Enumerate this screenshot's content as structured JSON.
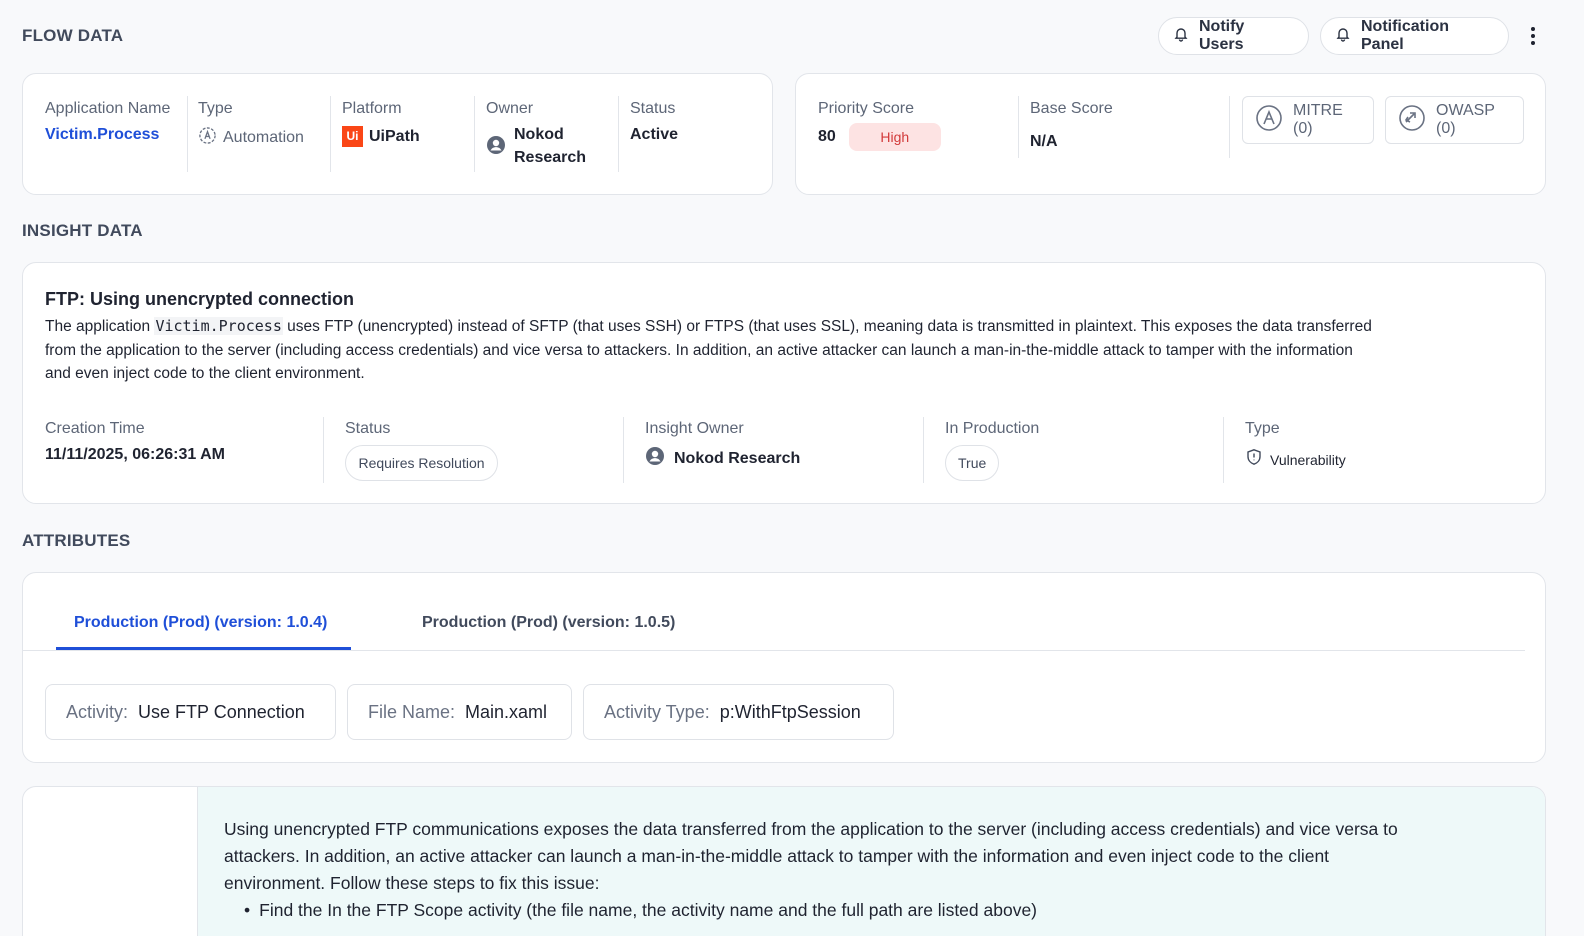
{
  "flow": {
    "section_title": "FLOW DATA",
    "notify_users_label": "Notify Users",
    "notification_panel_label": "Notification Panel",
    "application_name_label": "Application Name",
    "application_name": "Victim.Process",
    "type_label": "Type",
    "type_value": "Automation",
    "platform_label": "Platform",
    "platform_logo_text": "Ui",
    "platform_value": "UiPath",
    "owner_label": "Owner",
    "owner_line1": "Nokod",
    "owner_line2": "Research",
    "status_label": "Status",
    "status_value": "Active",
    "priority_score_label": "Priority Score",
    "priority_score": "80",
    "priority_level": "High",
    "base_score_label": "Base Score",
    "base_score": "N/A",
    "mitre_label": "MITRE (0)",
    "owasp_label": "OWASP (0)"
  },
  "insight": {
    "section_title": "INSIGHT DATA",
    "title": "FTP: Using unencrypted connection",
    "desc_prefix": "The application ",
    "desc_code": "Victim.Process",
    "desc_line1_rest": " uses FTP (unencrypted) instead of SFTP (that uses SSH) or FTPS (that uses SSL), meaning data is transmitted in plaintext. This exposes the data transferred",
    "desc_line2": "from the application to the server (including access credentials) and vice versa to attackers. In addition, an active attacker can launch a man-in-the-middle attack to tamper with the information",
    "desc_line3": "and even inject code to the client environment.",
    "creation_time_label": "Creation Time",
    "creation_time": "11/11/2025, 06:26:31 AM",
    "status_label": "Status",
    "status_value": "Requires Resolution",
    "owner_label": "Insight Owner",
    "owner_value": "Nokod Research",
    "in_production_label": "In Production",
    "in_production_value": "True",
    "type_label": "Type",
    "type_value": "Vulnerability"
  },
  "attributes": {
    "section_title": "ATTRIBUTES",
    "tabs": [
      {
        "label": "Production (Prod) (version: 1.0.4)",
        "active": true
      },
      {
        "label": "Production (Prod) (version: 1.0.5)",
        "active": false
      }
    ],
    "items": [
      {
        "key": "Activity:",
        "value": "Use FTP Connection"
      },
      {
        "key": "File Name:",
        "value": "Main.xaml"
      },
      {
        "key": "Activity Type:",
        "value": "p:WithFtpSession"
      }
    ]
  },
  "remediation": {
    "line1": "Using unencrypted FTP communications exposes the data transferred from the application to the server (including access credentials) and vice versa to",
    "line2": "attackers. In addition, an active attacker can launch a man-in-the-middle attack to tamper with the information and even inject code to the client",
    "line3": "environment. Follow these steps to fix this issue:",
    "bullets": [
      "Find the In the FTP Scope activity (the file name, the activity name and the full path are listed above)"
    ]
  },
  "colors": {
    "accent": "#1f4fd8",
    "high_bg": "#fde3e3",
    "high_text": "#d23a3a",
    "uipath": "#fa4616",
    "remediation_bg": "#eef9f9"
  }
}
